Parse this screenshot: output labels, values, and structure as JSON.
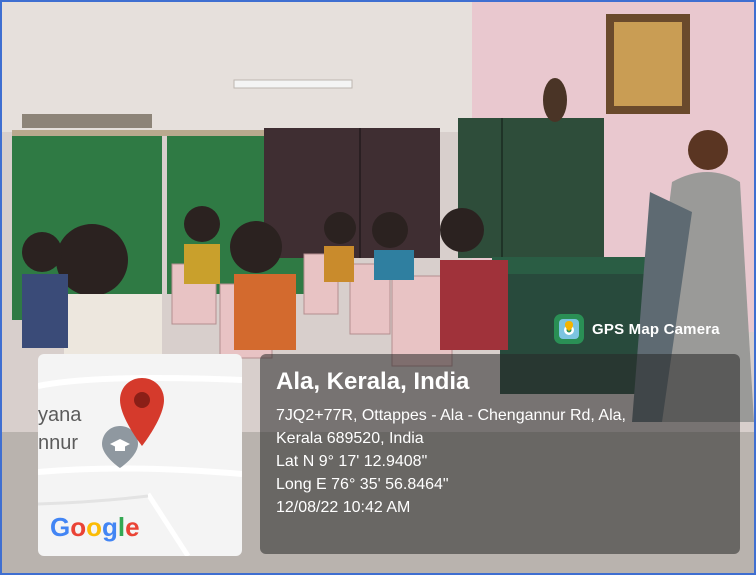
{
  "overlay": {
    "app_badge": "GPS Map Camera",
    "place_title": "Ala, Kerala, India",
    "address_line1": "7JQ2+77R, Ottappes - Ala - Chengannur Rd, Ala,",
    "address_line2": "Kerala 689520, India",
    "latitude": "Lat N 9° 17' 12.9408\"",
    "longitude": "Long E 76° 35' 56.8464\"",
    "datetime": "12/08/22 10:42 AM"
  },
  "map": {
    "text_top": "yana",
    "text_bottom": "nnur",
    "brand": {
      "g1": "G",
      "o1": "o",
      "o2": "o",
      "g2": "g",
      "l": "l",
      "e": "e"
    },
    "icons": [
      "location-pin-icon",
      "graduation-cap-icon"
    ]
  },
  "colors": {
    "frame_border": "#3f6fd1",
    "chalkboard": "#2f7a44",
    "pin_red": "#d53a2c"
  }
}
